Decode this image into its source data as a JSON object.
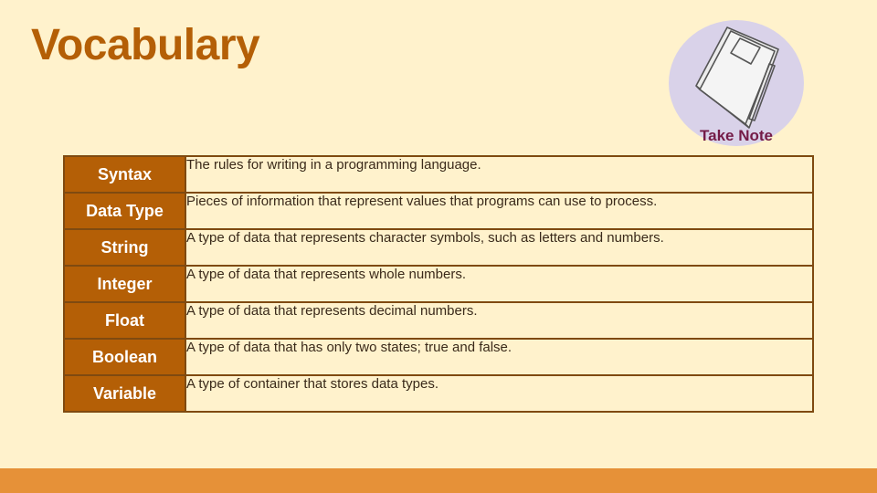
{
  "slide": {
    "title": "Vocabulary",
    "badge": {
      "label": "Take Note",
      "icon": "notebook-icon"
    }
  },
  "vocabulary": [
    {
      "term": "Syntax",
      "definition": "The rules for writing in a programming language."
    },
    {
      "term": "Data Type",
      "definition": "Pieces of information that represent values that programs can use to process."
    },
    {
      "term": "String",
      "definition": "A type of data that represents character symbols, such as letters and numbers."
    },
    {
      "term": "Integer",
      "definition": "A type of data that represents whole numbers."
    },
    {
      "term": "Float",
      "definition": "A type of data that represents decimal numbers."
    },
    {
      "term": "Boolean",
      "definition": "A type of data that has only two states; true and false."
    },
    {
      "term": "Variable",
      "definition": "A type of container that stores data types."
    }
  ],
  "colors": {
    "background": "#fff2cc",
    "title": "#b45f06",
    "term_cell": "#b45f06",
    "badge_circle": "#d9d2e9",
    "badge_label": "#741b47",
    "footer_bar": "#e69138"
  }
}
